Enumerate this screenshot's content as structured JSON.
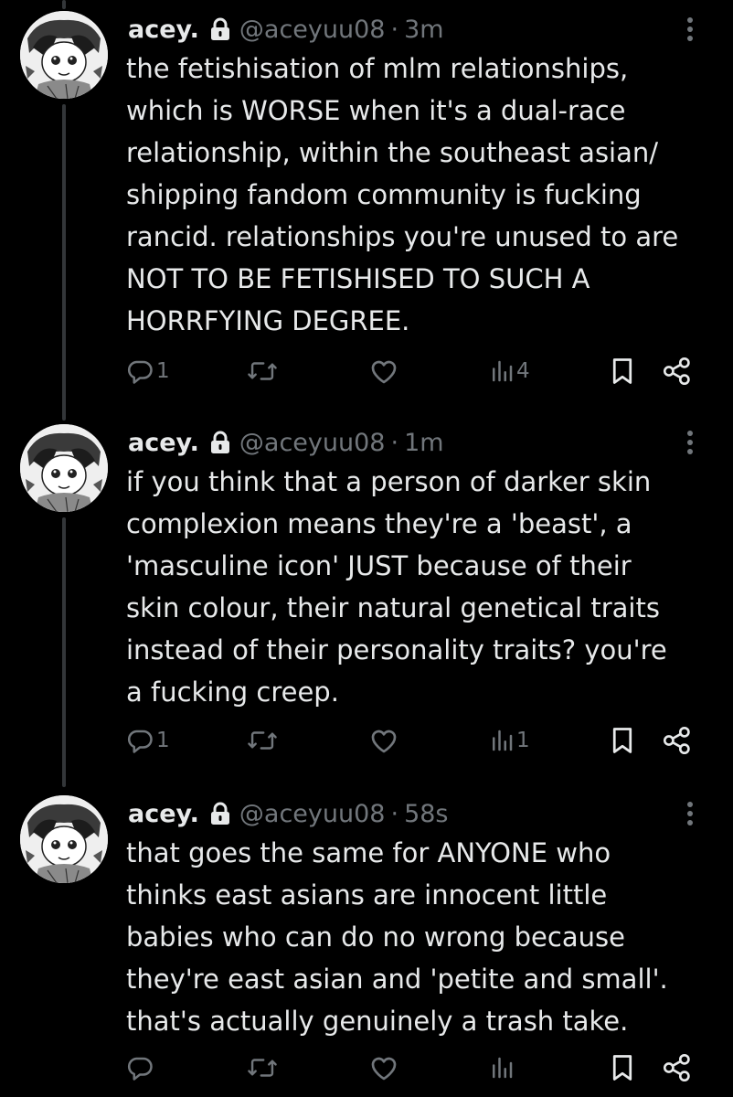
{
  "colors": {
    "background": "#000000",
    "text": "#e7e9ea",
    "secondary": "#71767b",
    "thread_line": "#333639"
  },
  "tweets": [
    {
      "display_name": "acey.",
      "handle": "@aceyuu08",
      "separator": "·",
      "time": "3m",
      "text": "the fetishisation of mlm relationships,\nwhich is WORSE when it's a dual-race\nrelationship, within the southeast asian/\nshipping fandom community is fucking\nrancid. relationships you're unused to are\nNOT TO BE FETISHISED TO SUCH A\nHORRFYING DEGREE.",
      "reply_count": "1",
      "retweet_count": "",
      "like_count": "",
      "view_count": "4"
    },
    {
      "display_name": "acey.",
      "handle": "@aceyuu08",
      "separator": "·",
      "time": "1m",
      "text": "if you think that a person of darker skin\ncomplexion means they're a 'beast', a\n'masculine icon' JUST because of their\nskin colour, their natural genetical traits\ninstead of their personality traits? you're\na fucking creep.",
      "reply_count": "1",
      "retweet_count": "",
      "like_count": "",
      "view_count": "1"
    },
    {
      "display_name": "acey.",
      "handle": "@aceyuu08",
      "separator": "·",
      "time": "58s",
      "text": "that goes the same for ANYONE who\nthinks east asians are innocent little\nbabies who can do no wrong because\nthey're east asian and 'petite and small'.\nthat's actually genuinely a trash take.",
      "reply_count": "",
      "retweet_count": "",
      "like_count": "",
      "view_count": ""
    }
  ],
  "icons": {
    "reply": "reply-icon",
    "retweet": "retweet-icon",
    "like": "heart-icon",
    "views": "views-icon",
    "bookmark": "bookmark-icon",
    "share": "share-icon",
    "more": "more-icon",
    "protected": "lock-icon"
  }
}
